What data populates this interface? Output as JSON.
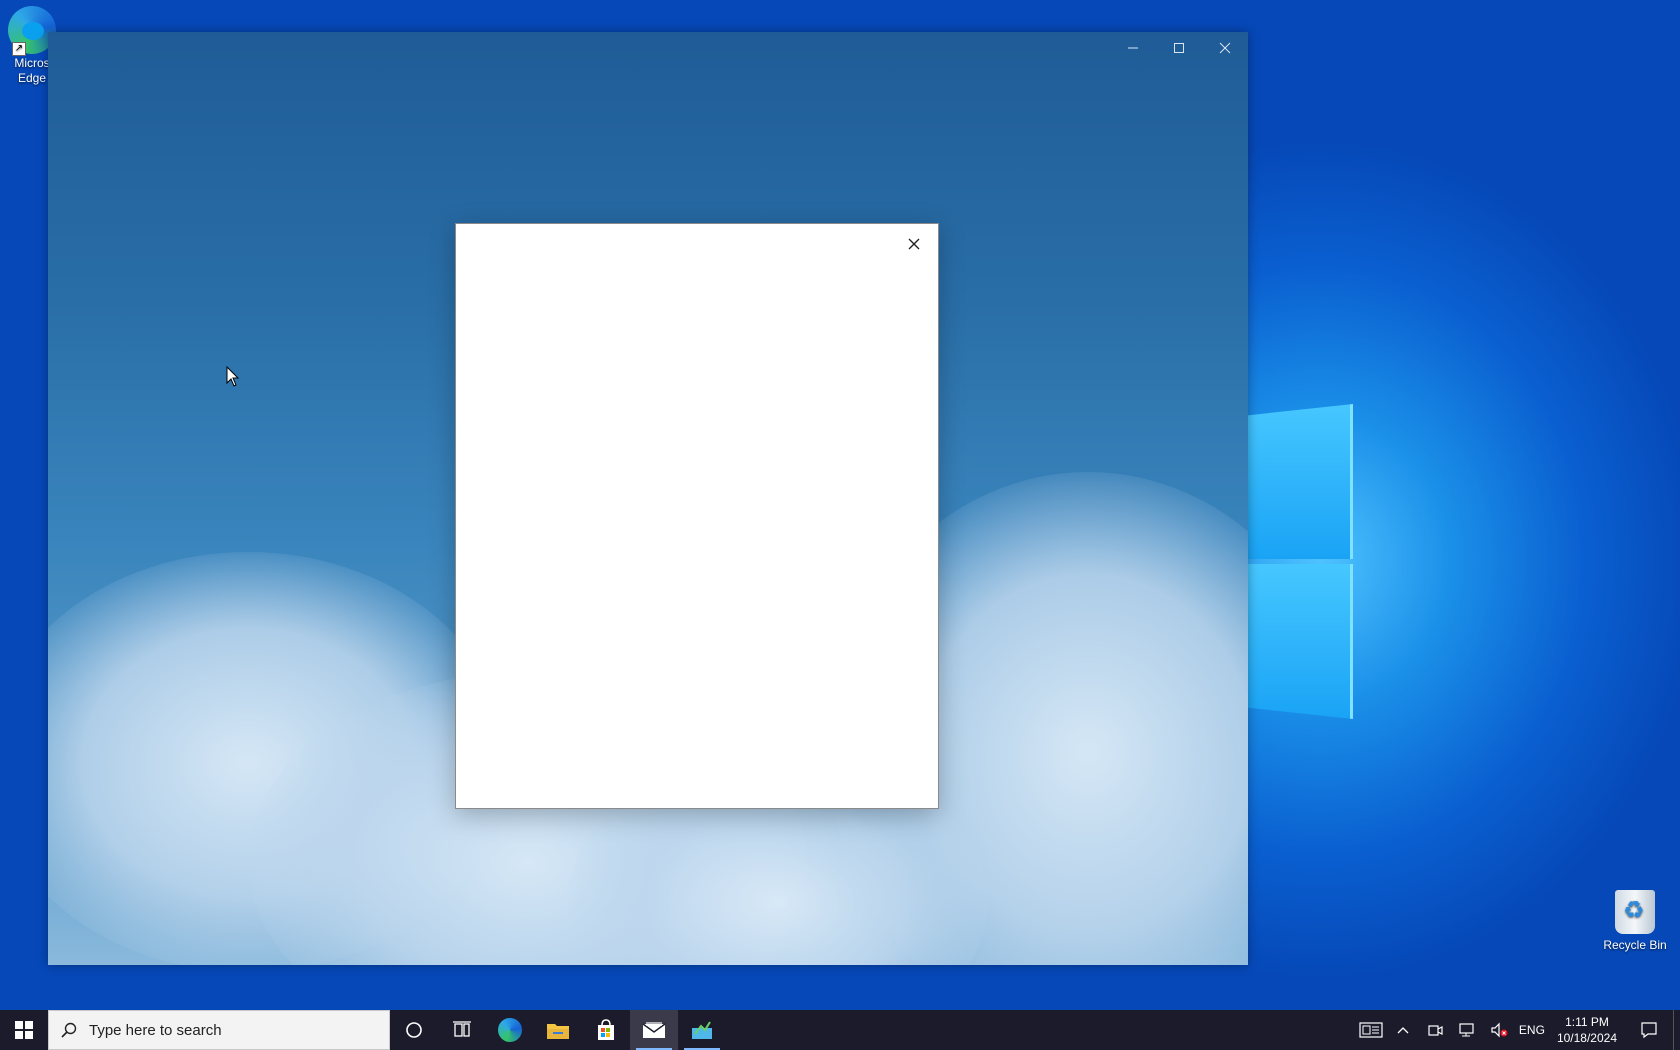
{
  "desktop": {
    "icons": [
      {
        "label_line1": "Micros",
        "label_line2": "Edge"
      },
      {
        "label": "Recycle Bin"
      }
    ]
  },
  "taskbar": {
    "search_placeholder": "Type here to search",
    "pinned": [
      "cortana-icon",
      "task-view-icon",
      "edge-icon",
      "file-explorer-icon",
      "store-icon",
      "mail-icon",
      "app-icon"
    ],
    "tray": {
      "language": "ENG",
      "time": "1:11 PM",
      "date": "10/18/2024"
    }
  },
  "colors": {
    "taskbar": "#1b1b2b",
    "accent": "#7fb8ff"
  }
}
